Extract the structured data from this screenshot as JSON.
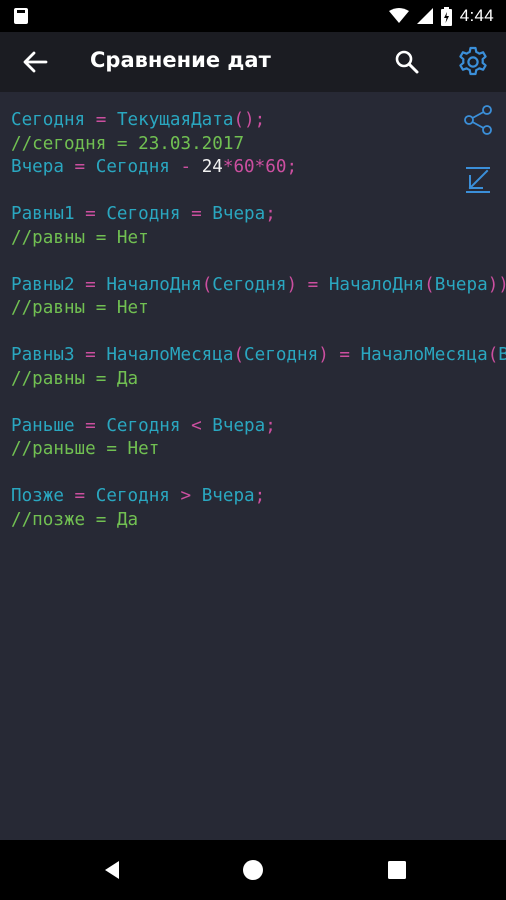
{
  "status": {
    "time": "4:44"
  },
  "app_bar": {
    "title": "Сравнение дат"
  },
  "colors": {
    "accent": "#3b8fd9",
    "identifier": "#2aa7c0",
    "operator": "#cc4fa0",
    "comment": "#71c052",
    "background": "#272935"
  },
  "code": [
    [
      {
        "t": "Сегодня",
        "c": "id"
      },
      {
        "t": " = ",
        "c": "op"
      },
      {
        "t": "ТекущаяДата",
        "c": "id"
      },
      {
        "t": "();",
        "c": "op"
      }
    ],
    [
      {
        "t": "//сегодня = 23.03.2017",
        "c": "cm"
      }
    ],
    [
      {
        "t": "Вчера",
        "c": "id"
      },
      {
        "t": " = ",
        "c": "op"
      },
      {
        "t": "Сегодня",
        "c": "id"
      },
      {
        "t": " - ",
        "c": "op"
      },
      {
        "t": "24",
        "c": "num"
      },
      {
        "t": "*",
        "c": "op"
      },
      {
        "t": "60",
        "c": "num2"
      },
      {
        "t": "*",
        "c": "op"
      },
      {
        "t": "60",
        "c": "num2"
      },
      {
        "t": ";",
        "c": "op"
      }
    ],
    [],
    [
      {
        "t": "Равны1",
        "c": "id"
      },
      {
        "t": " = ",
        "c": "op"
      },
      {
        "t": "Сегодня",
        "c": "id"
      },
      {
        "t": " = ",
        "c": "op"
      },
      {
        "t": "Вчера",
        "c": "id"
      },
      {
        "t": ";",
        "c": "op"
      }
    ],
    [
      {
        "t": "//равны = Нет",
        "c": "cm"
      }
    ],
    [],
    [
      {
        "t": "Равны2",
        "c": "id"
      },
      {
        "t": " = ",
        "c": "op"
      },
      {
        "t": "НачалоДня",
        "c": "id"
      },
      {
        "t": "(",
        "c": "op"
      },
      {
        "t": "Сегодня",
        "c": "id"
      },
      {
        "t": ")",
        "c": "op"
      },
      {
        "t": " = ",
        "c": "op"
      },
      {
        "t": "НачалоДня",
        "c": "id"
      },
      {
        "t": "(",
        "c": "op"
      },
      {
        "t": "Вчера",
        "c": "id"
      },
      {
        "t": "));",
        "c": "op"
      }
    ],
    [
      {
        "t": "//равны = Нет",
        "c": "cm"
      }
    ],
    [],
    [
      {
        "t": "Равны3",
        "c": "id"
      },
      {
        "t": " = ",
        "c": "op"
      },
      {
        "t": "НачалоМесяца",
        "c": "id"
      },
      {
        "t": "(",
        "c": "op"
      },
      {
        "t": "Сегодня",
        "c": "id"
      },
      {
        "t": ")",
        "c": "op"
      },
      {
        "t": " = ",
        "c": "op"
      },
      {
        "t": "НачалоМесяца",
        "c": "id"
      },
      {
        "t": "(",
        "c": "op"
      },
      {
        "t": "Вчера",
        "c": "id"
      },
      {
        "t": "));",
        "c": "op"
      }
    ],
    [
      {
        "t": "//равны = Да",
        "c": "cm"
      }
    ],
    [],
    [
      {
        "t": "Раньше",
        "c": "id"
      },
      {
        "t": " = ",
        "c": "op"
      },
      {
        "t": "Сегодня",
        "c": "id"
      },
      {
        "t": " < ",
        "c": "op"
      },
      {
        "t": "Вчера",
        "c": "id"
      },
      {
        "t": ";",
        "c": "op"
      }
    ],
    [
      {
        "t": "//раньше = Нет",
        "c": "cm"
      }
    ],
    [],
    [
      {
        "t": "Позже",
        "c": "id"
      },
      {
        "t": " = ",
        "c": "op"
      },
      {
        "t": "Сегодня",
        "c": "id"
      },
      {
        "t": " > ",
        "c": "op"
      },
      {
        "t": "Вчера",
        "c": "id"
      },
      {
        "t": ";",
        "c": "op"
      }
    ],
    [
      {
        "t": "//позже = Да",
        "c": "cm"
      }
    ]
  ]
}
